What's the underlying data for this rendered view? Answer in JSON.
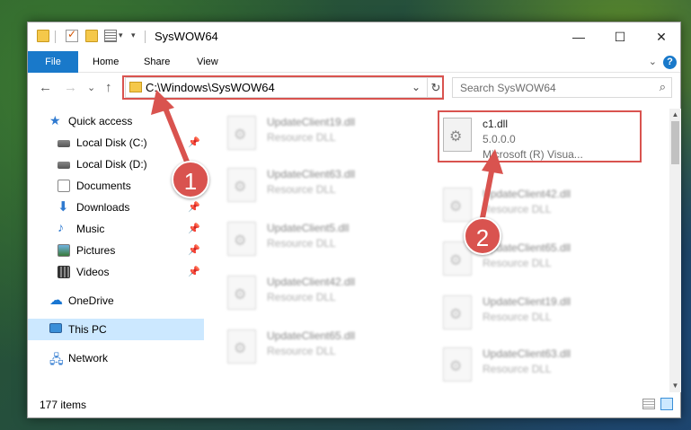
{
  "window": {
    "title": "SysWOW64",
    "controls": {
      "minimize": "—",
      "maximize": "☐",
      "close": "✕"
    }
  },
  "ribbon": {
    "tabs": [
      "File",
      "Home",
      "Share",
      "View"
    ],
    "help": "?",
    "expand_chevron": "⌄"
  },
  "nav": {
    "back": "←",
    "forward": "→",
    "recent": "⌄",
    "up": "↑"
  },
  "address": {
    "path": "C:\\Windows\\SysWOW64",
    "dropdown": "⌄",
    "refresh": "↻"
  },
  "search": {
    "placeholder": "Search SysWOW64",
    "icon": "search-icon"
  },
  "sidebar": {
    "items": [
      {
        "label": "Quick access",
        "icon": "star-icon",
        "pinned": false
      },
      {
        "label": "Local Disk (C:)",
        "icon": "disk-icon",
        "pinned": true
      },
      {
        "label": "Local Disk (D:)",
        "icon": "disk-icon",
        "pinned": false
      },
      {
        "label": "Documents",
        "icon": "documents-icon",
        "pinned": true
      },
      {
        "label": "Downloads",
        "icon": "download-icon",
        "pinned": true
      },
      {
        "label": "Music",
        "icon": "music-icon",
        "pinned": true
      },
      {
        "label": "Pictures",
        "icon": "pictures-icon",
        "pinned": true
      },
      {
        "label": "Videos",
        "icon": "videos-icon",
        "pinned": true
      },
      {
        "label": "OneDrive",
        "icon": "cloud-icon",
        "pinned": false
      },
      {
        "label": "This PC",
        "icon": "pc-icon",
        "pinned": false,
        "selected": true
      },
      {
        "label": "Network",
        "icon": "network-icon",
        "pinned": false
      }
    ]
  },
  "files": {
    "highlighted": {
      "name": "c1.dll",
      "version": "5.0.0.0",
      "description": "Microsoft (R) Visua..."
    },
    "left_column": [
      {
        "name": "UpdateClient19.dll",
        "type": "Resource DLL"
      },
      {
        "name": "UpdateClient63.dll",
        "type": "Resource DLL"
      },
      {
        "name": "UpdateClient5.dll",
        "type": "Resource DLL"
      },
      {
        "name": "UpdateClient42.dll",
        "type": "Resource DLL"
      },
      {
        "name": "UpdateClient65.dll",
        "type": "Resource DLL"
      }
    ],
    "right_column": [
      {
        "name": "UpdateClient42.dll",
        "type": "Resource DLL"
      },
      {
        "name": "UpdateClient65.dll",
        "type": "Resource DLL"
      },
      {
        "name": "UpdateClient19.dll",
        "type": "Resource DLL"
      },
      {
        "name": "UpdateClient63.dll",
        "type": "Resource DLL"
      }
    ]
  },
  "status": {
    "item_count": "177 items"
  },
  "callouts": {
    "step1": "1",
    "step2": "2",
    "color": "#d9534f"
  }
}
